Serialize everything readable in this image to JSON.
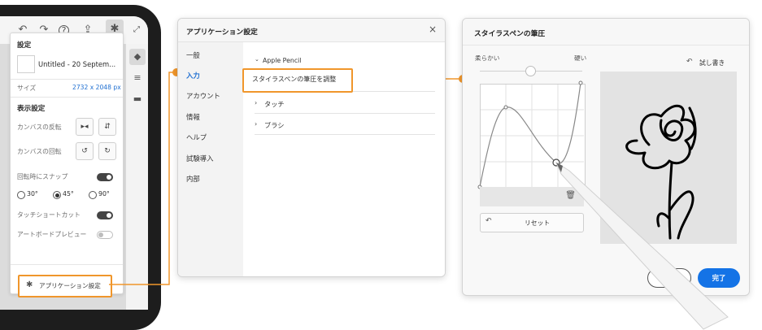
{
  "tablet": {
    "toolbar": {
      "undo_icon": "undo-icon",
      "redo_icon": "redo-icon",
      "help_icon": "help-icon",
      "share_icon": "share-icon",
      "settings_icon": "gear-icon",
      "expand_icon": "expand-icon"
    },
    "settings_panel": {
      "heading": "設定",
      "doc_name": "Untitled - 20 Septem...",
      "size_label": "サイズ",
      "size_value": "2732 x 2048 px",
      "display_heading": "表示設定",
      "canvas_flip_label": "カンバスの反転",
      "canvas_rotate_label": "カンバスの回転",
      "snap_label": "回転時にスナップ",
      "snap_options": [
        "30°",
        "45°",
        "90°"
      ],
      "snap_selected": "45°",
      "touch_shortcut_label": "タッチショートカット",
      "artboard_preview_label": "アートボードプレビュー",
      "app_settings_label": "アプリケーション設定"
    }
  },
  "dialog1": {
    "title": "アプリケーション設定",
    "close_icon": "close-icon",
    "nav": [
      "一般",
      "入力",
      "アカウント",
      "情報",
      "ヘルプ",
      "試験導入",
      "内部"
    ],
    "nav_active": "入力",
    "section": "Apple Pencil",
    "highlighted_item": "スタイラスペンの筆圧を調整",
    "rows": [
      "タッチ",
      "ブラシ"
    ]
  },
  "dialog2": {
    "title": "スタイラスペンの筆圧",
    "soft_label": "柔らかい",
    "hard_label": "硬い",
    "try_label": "試し書き",
    "reset_label": "リセット",
    "done_label": "完了",
    "accent": "#1473e6",
    "highlight": "#f0962b"
  }
}
